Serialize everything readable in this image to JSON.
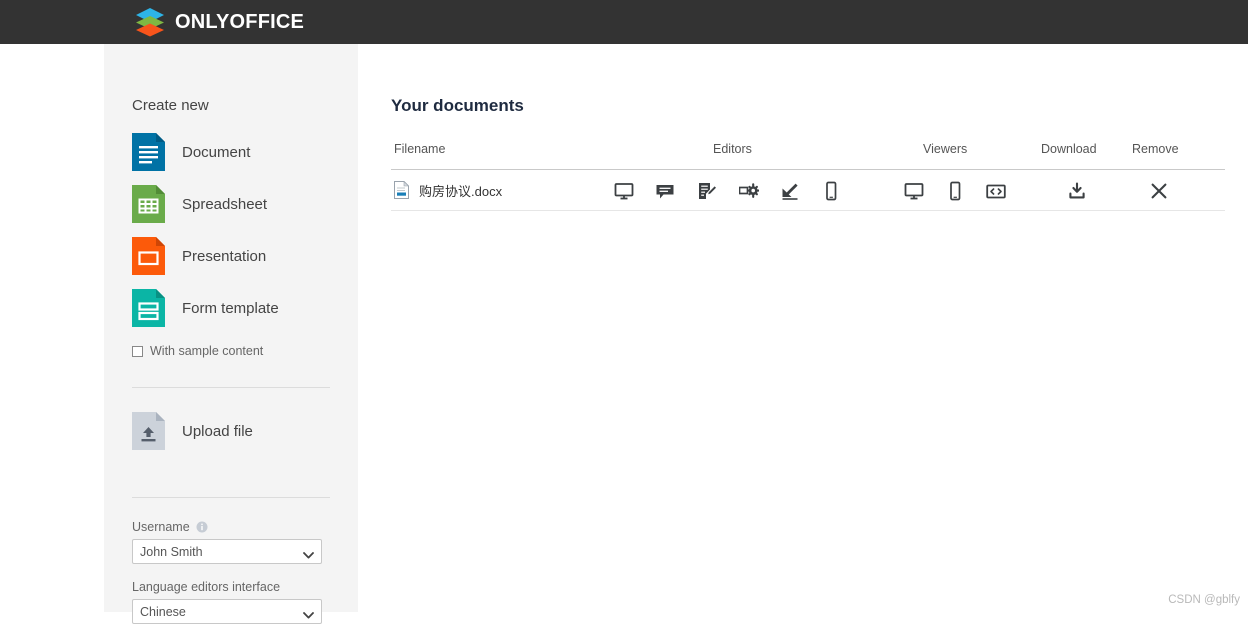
{
  "app": {
    "brand": "ONLYOFFICE",
    "logo_icon": "onlyoffice-layers-logo",
    "topbar_color": "#333333"
  },
  "sidebar": {
    "create_heading": "Create new",
    "create_items": [
      {
        "label": "Document",
        "icon": "document-icon",
        "color": "#0072a5"
      },
      {
        "label": "Spreadsheet",
        "icon": "spreadsheet-icon",
        "color": "#6aab4a"
      },
      {
        "label": "Presentation",
        "icon": "presentation-icon",
        "color": "#fc5a0a"
      },
      {
        "label": "Form template",
        "icon": "form-template-icon",
        "color": "#0bb5a5"
      }
    ],
    "sample_content": {
      "label": "With sample content",
      "checked": false
    },
    "upload": {
      "label": "Upload file",
      "icon": "upload-file-icon"
    },
    "username": {
      "label": "Username",
      "info_icon": "info-icon",
      "value": "John Smith",
      "options": [
        "John Smith"
      ]
    },
    "language": {
      "label": "Language editors interface",
      "value": "Chinese",
      "options": [
        "Chinese"
      ]
    }
  },
  "main": {
    "title": "Your documents",
    "columns": {
      "filename": "Filename",
      "editors": "Editors",
      "viewers": "Viewers",
      "download": "Download",
      "remove": "Remove"
    },
    "rows": [
      {
        "filename": "购房协议.docx",
        "file_icon": "docx-file-icon",
        "editors": [
          {
            "icon": "desktop-editor-icon"
          },
          {
            "icon": "comment-editor-icon"
          },
          {
            "icon": "review-editor-icon"
          },
          {
            "icon": "custom-settings-editor-icon"
          },
          {
            "icon": "fill-form-editor-icon"
          },
          {
            "icon": "mobile-editor-icon"
          }
        ],
        "viewers": [
          {
            "icon": "desktop-viewer-icon"
          },
          {
            "icon": "mobile-viewer-icon"
          },
          {
            "icon": "embedded-viewer-icon"
          }
        ],
        "download_icon": "download-icon",
        "remove_icon": "remove-x-icon"
      }
    ]
  },
  "watermark": "CSDN @gblfy"
}
